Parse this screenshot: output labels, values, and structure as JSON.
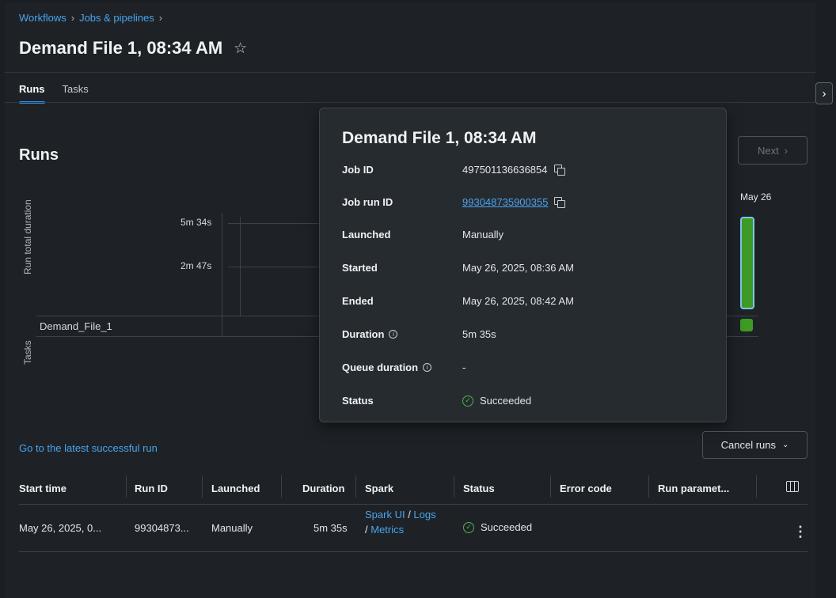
{
  "breadcrumb": [
    "Workflows",
    "Jobs & pipelines"
  ],
  "title": "Demand File 1, 08:34 AM",
  "tabs": [
    {
      "label": "Runs",
      "active": true
    },
    {
      "label": "Tasks",
      "active": false
    }
  ],
  "runs_section": {
    "title": "Runs",
    "next_label": "Next"
  },
  "chart": {
    "ylabel": "Run total duration",
    "tasks_label": "Tasks",
    "ticks": [
      "5m 34s",
      "2m 47s"
    ],
    "task_name": "Demand_File_1",
    "date_label": "May 26",
    "run_duration_fraction_of_top_tick": 1.0
  },
  "popover": {
    "title": "Demand File 1, 08:34 AM",
    "rows": [
      {
        "key": "Job ID",
        "value": "497501136636854"
      },
      {
        "key": "Job run ID",
        "value": "993048735900355"
      },
      {
        "key": "Launched",
        "value": "Manually"
      },
      {
        "key": "Started",
        "value": "May 26, 2025, 08:36 AM"
      },
      {
        "key": "Ended",
        "value": "May 26, 2025, 08:42 AM"
      },
      {
        "key": "Duration",
        "value": "5m 35s"
      },
      {
        "key": "Queue duration",
        "value": "-"
      },
      {
        "key": "Status",
        "value": "Succeeded"
      }
    ]
  },
  "latest_link": "Go to the latest successful run",
  "cancel_runs": "Cancel runs",
  "table": {
    "headers": [
      "Start time",
      "Run ID",
      "Launched",
      "Duration",
      "Spark",
      "Status",
      "Error code",
      "Run paramet..."
    ],
    "rows": [
      {
        "start_time": "May 26, 2025, 0...",
        "run_id": "99304873...",
        "launched": "Manually",
        "duration": "5m 35s",
        "spark_ui": "Spark UI",
        "logs": "Logs",
        "metrics": "Metrics",
        "status": "Succeeded"
      }
    ]
  },
  "colors": {
    "accent": "#4aa3ef",
    "success": "#3f9a25",
    "background": "#1e2226"
  }
}
